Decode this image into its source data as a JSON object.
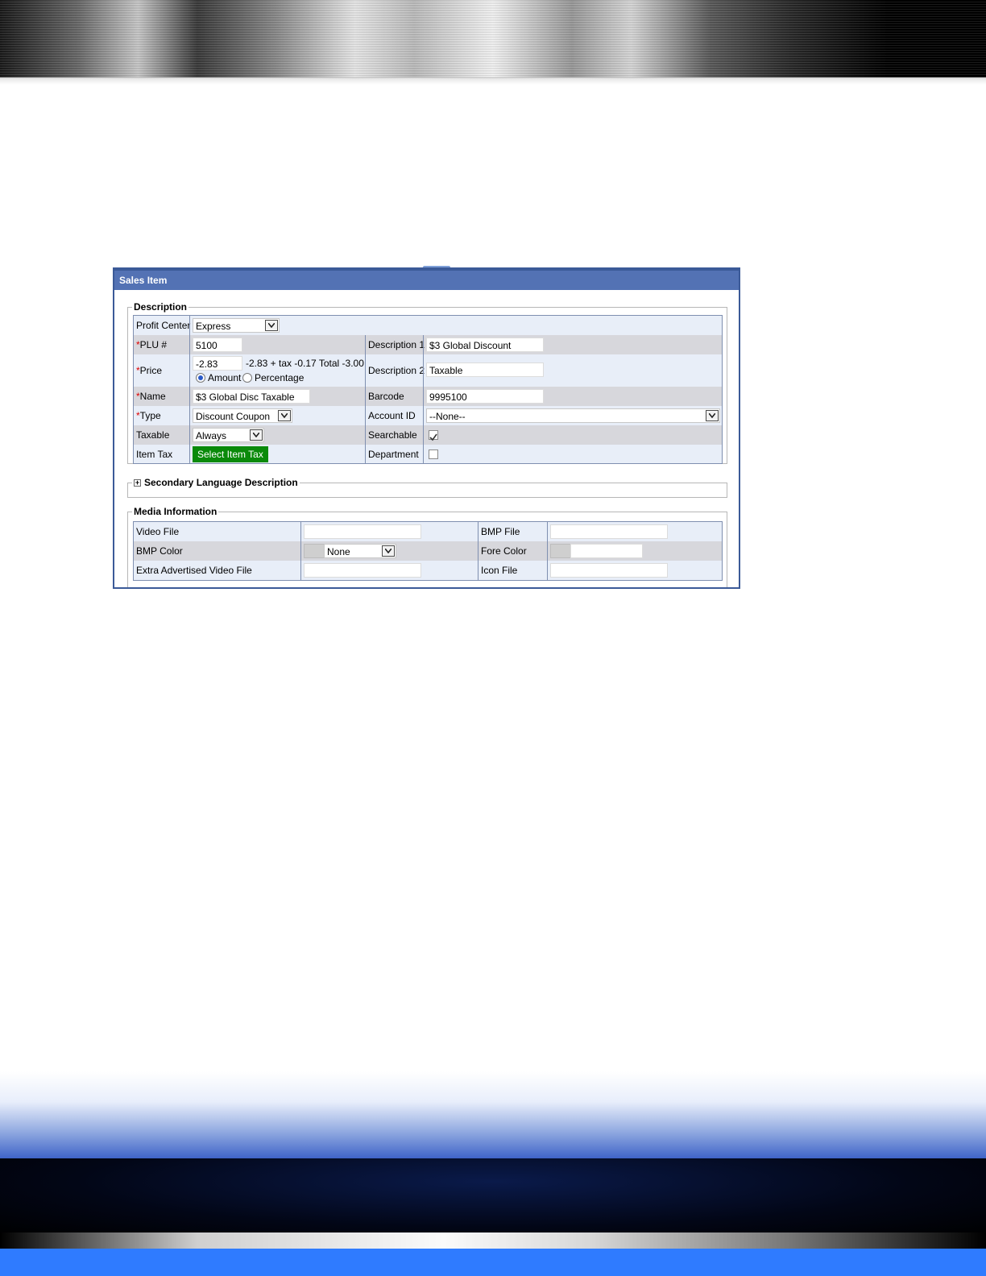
{
  "window": {
    "title": "Sales Item"
  },
  "description": {
    "legend": "Description",
    "profit_center": {
      "label": "Profit Center",
      "value": "Express"
    },
    "plu": {
      "req": "*",
      "label": "PLU #",
      "value": "5100"
    },
    "price": {
      "req": "*",
      "label": "Price",
      "value": "-2.83",
      "summary": "-2.83 + tax -0.17 Total -3.00",
      "radio_amount": "Amount",
      "radio_percentage": "Percentage",
      "selected": "Amount"
    },
    "name": {
      "req": "*",
      "label": "Name",
      "value": "$3 Global Disc Taxable"
    },
    "type": {
      "req": "*",
      "label": "Type",
      "value": "Discount Coupon"
    },
    "taxable": {
      "label": "Taxable",
      "value": "Always"
    },
    "item_tax": {
      "label": "Item Tax",
      "button": "Select Item Tax"
    },
    "description1": {
      "label": "Description 1",
      "value": "$3 Global Discount"
    },
    "description2": {
      "label": "Description 2",
      "value": "Taxable"
    },
    "barcode": {
      "label": "Barcode",
      "value": "9995100"
    },
    "account_id": {
      "label": "Account ID",
      "value": "--None--"
    },
    "searchable": {
      "label": "Searchable",
      "checked": true
    },
    "department": {
      "label": "Department",
      "checked": false
    }
  },
  "secondary_language": {
    "legend": "Secondary Language Description",
    "expander": "+"
  },
  "media": {
    "legend": "Media Information",
    "video_file": {
      "label": "Video File",
      "value": ""
    },
    "bmp_color": {
      "label": "BMP Color",
      "value": "None"
    },
    "extra_video": {
      "label": "Extra Advertised Video File",
      "value": ""
    },
    "bmp_file": {
      "label": "BMP File",
      "value": ""
    },
    "fore_color": {
      "label": "Fore Color",
      "value": ""
    },
    "icon_file": {
      "label": "Icon File",
      "value": ""
    }
  },
  "colors": {
    "title_bar": "#5372b4",
    "button_green": "#0a8a0a",
    "required": "#dd0000"
  }
}
